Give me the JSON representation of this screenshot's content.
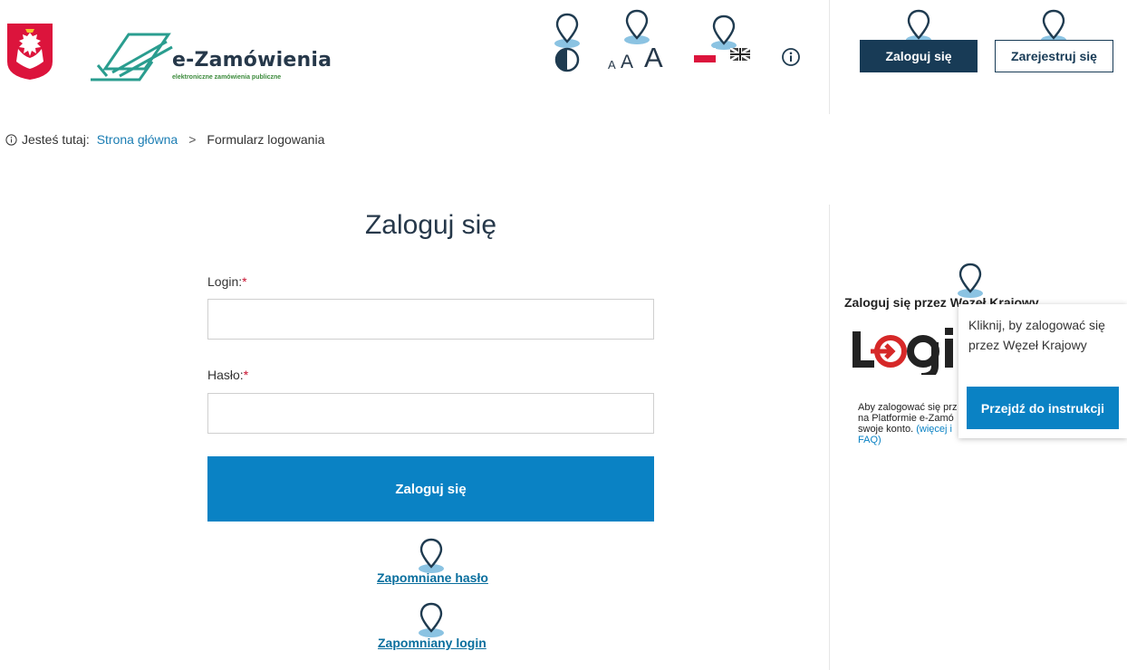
{
  "header": {
    "logo_name": "e-Zamówienia",
    "logo_subtitle": "elektroniczne zamówienia publiczne",
    "font_small": "A",
    "font_medium": "A",
    "font_large": "A",
    "login_button": "Zaloguj się",
    "register_button": "Zarejestruj się"
  },
  "breadcrumb": {
    "prefix": "Jesteś tutaj:",
    "home": "Strona główna",
    "separator": ">",
    "current": "Formularz logowania"
  },
  "form": {
    "title": "Zaloguj się",
    "login_label": "Login:",
    "password_label": "Hasło:",
    "required_mark": "*",
    "login_value": "",
    "password_value": "",
    "submit_button": "Zaloguj się",
    "forgot_password": "Zapomniane hasło",
    "forgot_login": "Zapomniany login"
  },
  "side": {
    "title": "Zaloguj się przez Węzeł Krajowy",
    "description_line1": "Aby zalogować się prz",
    "description_line2": "na Platformie e-Zamó",
    "description_line3": "swoje konto.",
    "description_link": "(więcej i",
    "description_line4": "FAQ)",
    "tooltip_text": "Kliknij, by zalogować się przez Węzeł Krajowy",
    "instructions_button": "Przejdź do instrukcji"
  },
  "colors": {
    "navy": "#183b56",
    "accent": "#0a82c4",
    "required": "#c8102e"
  }
}
